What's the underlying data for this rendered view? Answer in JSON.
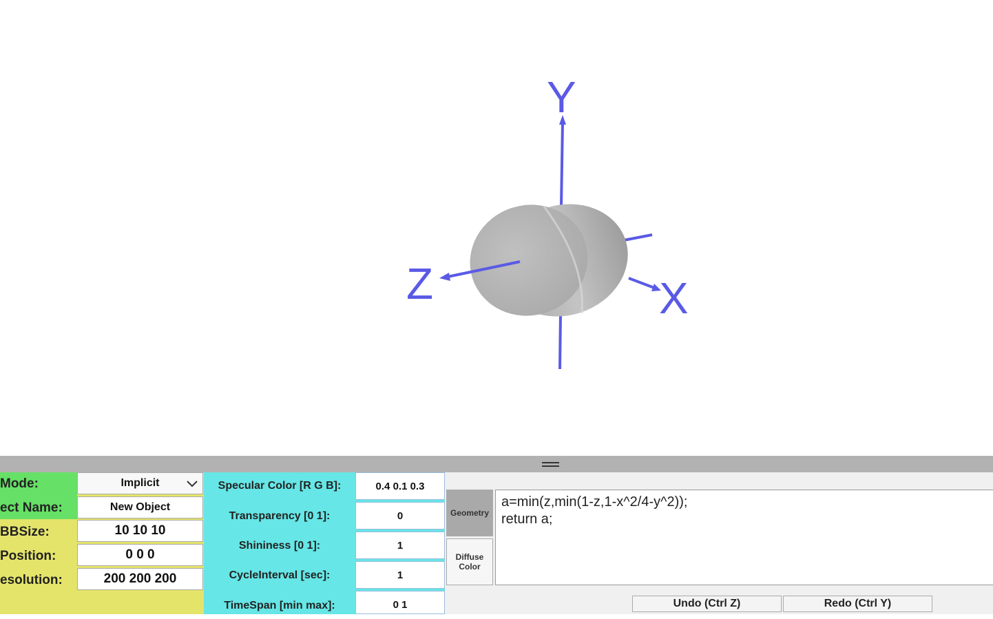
{
  "viewport": {
    "axes": {
      "x_label": "X",
      "y_label": "Y",
      "z_label": "Z"
    },
    "colors": {
      "axis": "#5a5ae6",
      "object": "#b8b8b8",
      "background": "#ffffff"
    }
  },
  "left_panel": {
    "mode": {
      "label": "Mode:",
      "value": "Implicit"
    },
    "object_name": {
      "label": "ect Name:",
      "value": "New Object"
    },
    "bbsize": {
      "label": "BBSize:",
      "value": "10 10 10"
    },
    "position": {
      "label": "Position:",
      "value": "0 0 0"
    },
    "resolution": {
      "label": "esolution:",
      "value": "200 200 200"
    },
    "colors": {
      "green": "#66e066",
      "yellow": "#e4e46a"
    }
  },
  "material_panel": {
    "specular": {
      "label": "Specular Color [R G B]:",
      "value": "0.4 0.1 0.3"
    },
    "transparency": {
      "label": "Transparency [0 1]:",
      "value": "0"
    },
    "shininess": {
      "label": "Shininess [0 1]:",
      "value": "1"
    },
    "cycle_interval": {
      "label": "CycleInterval [sec]:",
      "value": "1"
    },
    "timespan": {
      "label": "TimeSpan [min max]:",
      "value": "0 1"
    },
    "color": "#66e6e6"
  },
  "editor": {
    "tabs": [
      {
        "label": "Geometry",
        "active": true
      },
      {
        "label": "Diffuse Color",
        "active": false
      }
    ],
    "code_line_1": "a=min(z,min(1-z,1-x^2/4-y^2));",
    "code_line_2": "return a;",
    "undo_label": "Undo (Ctrl Z)",
    "redo_label": "Redo (Ctrl Y)"
  }
}
